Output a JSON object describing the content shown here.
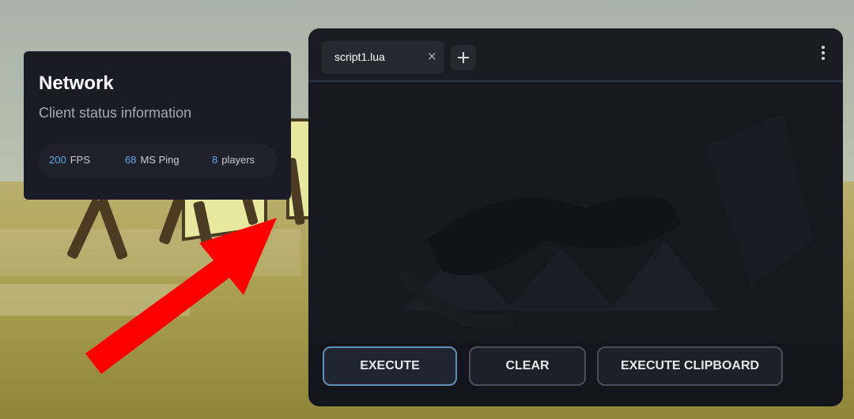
{
  "network": {
    "title": "Network",
    "subtitle": "Client status information",
    "stats": [
      {
        "value": "200",
        "label": "FPS"
      },
      {
        "value": "68",
        "label": "MS Ping"
      },
      {
        "value": "8",
        "label": "players"
      }
    ]
  },
  "editor": {
    "tabs": [
      {
        "label": "script1.lua",
        "close": "×"
      }
    ],
    "add_tab": "+",
    "buttons": {
      "execute": "EXECUTE",
      "clear": "CLEAR",
      "execute_clipboard": "EXECUTE CLIPBOARD"
    }
  },
  "colors": {
    "accent": "#5aa9e8",
    "panel": "#1a1b24",
    "arrow": "#ff0000"
  }
}
